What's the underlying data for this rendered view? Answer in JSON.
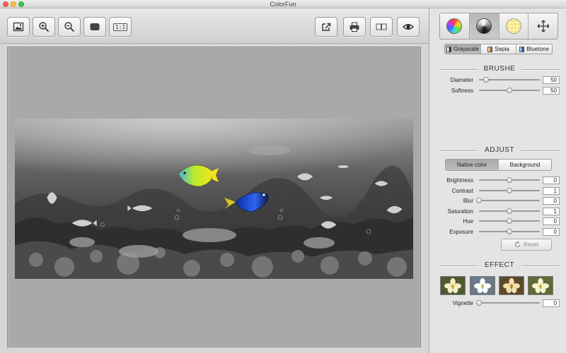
{
  "window": {
    "title": "ColorFun"
  },
  "toolbar": {
    "left_buttons": [
      {
        "id": "open-image",
        "icon": "image-icon"
      },
      {
        "id": "zoom-in",
        "icon": "zoom-in-icon"
      },
      {
        "id": "zoom-out",
        "icon": "zoom-out-icon"
      },
      {
        "id": "fit",
        "icon": "fit-screen-icon"
      },
      {
        "id": "actual-size",
        "icon": "actual-size-icon",
        "label": "1:1"
      }
    ],
    "right_buttons": [
      {
        "id": "share",
        "icon": "share-icon"
      },
      {
        "id": "print",
        "icon": "print-icon"
      },
      {
        "id": "compare",
        "icon": "compare-icon"
      },
      {
        "id": "preview",
        "icon": "eye-icon"
      }
    ]
  },
  "sidebar": {
    "modes": [
      {
        "id": "color-wheel",
        "icon": "color-wheel-icon",
        "active": false
      },
      {
        "id": "grayscale",
        "icon": "grayscale-wheel-icon",
        "active": true
      },
      {
        "id": "pattern",
        "icon": "pattern-icon",
        "active": false
      },
      {
        "id": "move",
        "icon": "move-icon",
        "active": false
      }
    ],
    "tone_tabs": [
      {
        "label": "Grayscale",
        "active": true,
        "swatch": "#444444"
      },
      {
        "label": "Sepia",
        "active": false,
        "swatch": "#b07a3c"
      },
      {
        "label": "Bluetone",
        "active": false,
        "swatch": "#2f5f9f"
      }
    ],
    "brush": {
      "heading": "BRUSHE",
      "sliders": [
        {
          "label": "Diameter",
          "value": "50",
          "pos": 0.12
        },
        {
          "label": "Softness",
          "value": "50",
          "pos": 0.5
        }
      ]
    },
    "adjust": {
      "heading": "ADJUST",
      "tabs": [
        {
          "label": "Native color",
          "active": true
        },
        {
          "label": "Background",
          "active": false
        }
      ],
      "sliders": [
        {
          "label": "Brightness",
          "value": "0",
          "pos": 0.5
        },
        {
          "label": "Contrast",
          "value": "1",
          "pos": 0.5
        },
        {
          "label": "Blur",
          "value": "0",
          "pos": 0.0
        },
        {
          "label": "Saturation",
          "value": "1",
          "pos": 0.5
        },
        {
          "label": "Hue",
          "value": "0",
          "pos": 0.5
        },
        {
          "label": "Exposure",
          "value": "0",
          "pos": 0.5
        }
      ],
      "reset_label": "Reset"
    },
    "effect": {
      "heading": "EFFECT",
      "thumbnails": [
        "effect-1",
        "effect-2",
        "effect-3",
        "effect-4"
      ],
      "vignette": {
        "label": "Vignette",
        "value": "0",
        "pos": 0.0
      }
    }
  }
}
